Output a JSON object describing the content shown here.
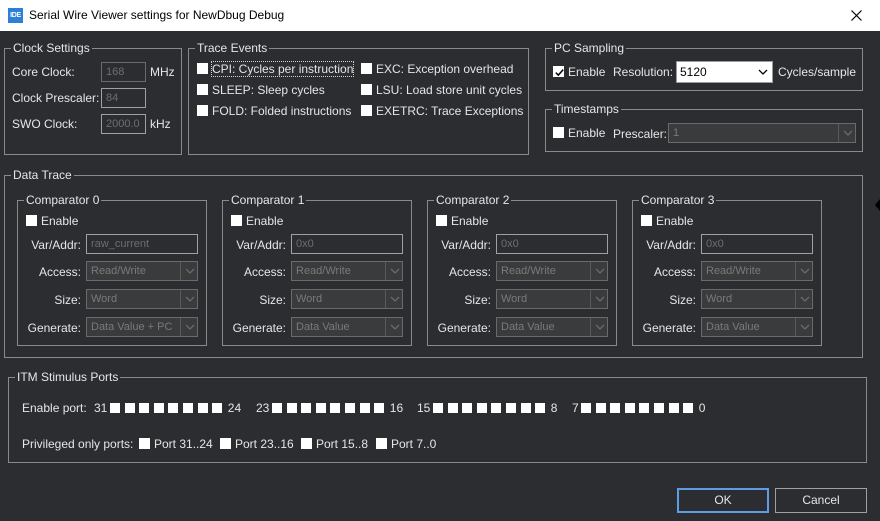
{
  "window": {
    "title": "Serial Wire Viewer settings for NewDbug Debug",
    "icon_text": "IDE",
    "close_icon": "close-icon"
  },
  "clock": {
    "legend": "Clock Settings",
    "core_label": "Core Clock:",
    "core_value": "168",
    "core_unit": "MHz",
    "prescaler_label": "Clock Prescaler:",
    "prescaler_value": "84",
    "swo_label": "SWO Clock:",
    "swo_value": "2000.0",
    "swo_unit": "kHz"
  },
  "trace": {
    "legend": "Trace Events",
    "cpi": "CPI: Cycles per instruction",
    "sleep": "SLEEP: Sleep cycles",
    "fold": "FOLD: Folded instructions",
    "exc": "EXC: Exception overhead",
    "lsu": "LSU: Load store unit cycles",
    "exetrc": "EXETRC: Trace Exceptions"
  },
  "pc": {
    "legend": "PC Sampling",
    "enable": "Enable",
    "enable_checked": true,
    "resolution_label": "Resolution:",
    "resolution_value": "5120",
    "unit": "Cycles/sample"
  },
  "timestamps": {
    "legend": "Timestamps",
    "enable": "Enable",
    "prescaler_label": "Prescaler:",
    "prescaler_value": "1"
  },
  "data_trace": {
    "legend": "Data Trace",
    "labels": {
      "enable": "Enable",
      "var": "Var/Addr:",
      "access": "Access:",
      "size": "Size:",
      "generate": "Generate:"
    },
    "comparators": [
      {
        "title": "Comparator 0",
        "var": "raw_current",
        "access": "Read/Write",
        "size": "Word",
        "generate": "Data Value + PC"
      },
      {
        "title": "Comparator 1",
        "var": "0x0",
        "access": "Read/Write",
        "size": "Word",
        "generate": "Data Value"
      },
      {
        "title": "Comparator 2",
        "var": "0x0",
        "access": "Read/Write",
        "size": "Word",
        "generate": "Data Value"
      },
      {
        "title": "Comparator 3",
        "var": "0x0",
        "access": "Read/Write",
        "size": "Word",
        "generate": "Data Value"
      }
    ]
  },
  "itm": {
    "legend": "ITM Stimulus Ports",
    "enable_port_label": "Enable port:",
    "groups": [
      {
        "start": "31",
        "end": "24"
      },
      {
        "start": "23",
        "end": "16"
      },
      {
        "start": "15",
        "end": "8"
      },
      {
        "start": "7",
        "end": "0"
      }
    ],
    "privileged_label": "Privileged only ports:",
    "privileged": [
      "Port 31..24",
      "Port 23..16",
      "Port 15..8",
      "Port 7..0"
    ]
  },
  "buttons": {
    "ok": "OK",
    "cancel": "Cancel"
  }
}
